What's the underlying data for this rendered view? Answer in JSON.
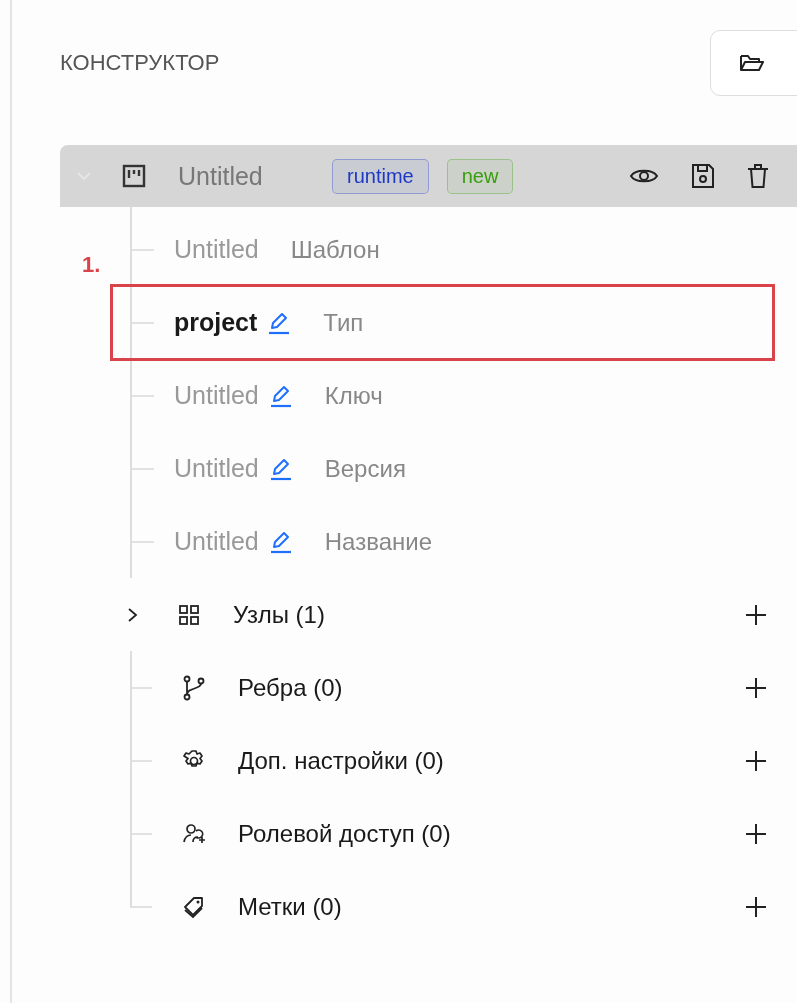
{
  "panel": {
    "title": "КОНСТРУКТОР"
  },
  "root": {
    "name": "Untitled",
    "expanded": true,
    "badges": [
      {
        "label": "runtime",
        "color": "#1d39c4"
      },
      {
        "label": "new",
        "color": "#389e0d"
      }
    ]
  },
  "fields": [
    {
      "placeholder": "Untitled",
      "editable": false,
      "label": "Шаблон"
    },
    {
      "value": "project",
      "editable": true,
      "label": "Тип",
      "annotation": "1."
    },
    {
      "placeholder": "Untitled",
      "editable": true,
      "label": "Ключ"
    },
    {
      "placeholder": "Untitled",
      "editable": true,
      "label": "Версия"
    },
    {
      "placeholder": "Untitled",
      "editable": true,
      "label": "Название"
    }
  ],
  "sections": [
    {
      "kind": "nodes",
      "label": "Узлы (1)",
      "expanded": false
    },
    {
      "kind": "edges",
      "label": "Ребра (0)"
    },
    {
      "kind": "settings",
      "label": "Доп. настройки (0)"
    },
    {
      "kind": "roles",
      "label": "Ролевой доступ (0)"
    },
    {
      "kind": "tags",
      "label": "Метки (0)"
    }
  ]
}
